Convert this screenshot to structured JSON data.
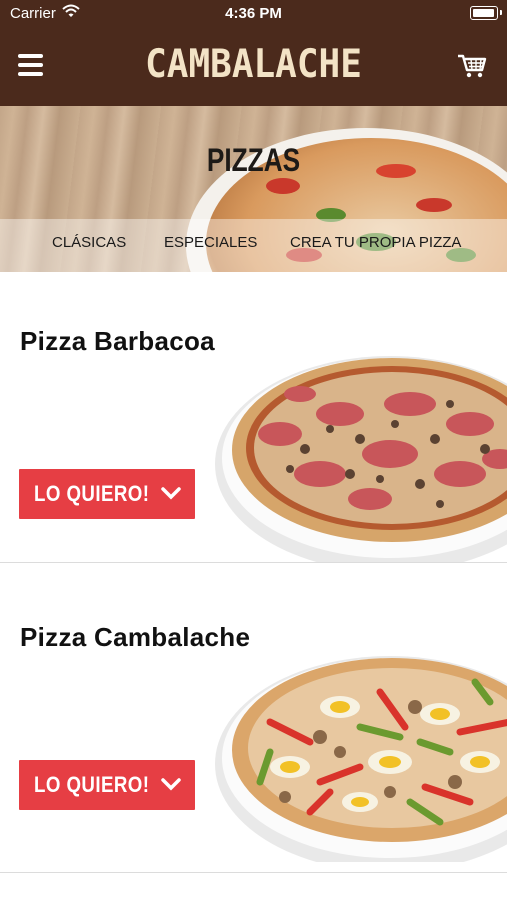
{
  "status_bar": {
    "carrier": "Carrier",
    "time": "4:36 PM",
    "wifi_icon": "wifi-icon",
    "battery_icon": "battery-icon",
    "background": "#4b2a1c"
  },
  "navbar": {
    "brand": "CAMBALACHE",
    "menu_icon": "hamburger-menu-icon",
    "cart_icon": "shopping-cart-icon",
    "background": "#4b2a1c",
    "brand_color": "#f3e3c6"
  },
  "hero": {
    "title": "PIZZAS",
    "tabs": [
      {
        "label": "CLÁSICAS"
      },
      {
        "label": "ESPECIALES"
      },
      {
        "label": "CREA TU PROPIA PIZZA"
      }
    ]
  },
  "products": [
    {
      "name": "Pizza Barbacoa",
      "button_label": "LO QUIERO!",
      "button_icon": "chevron-down-icon",
      "image": "pizza-barbacoa-image"
    },
    {
      "name": "Pizza Cambalache",
      "button_label": "LO QUIERO!",
      "button_icon": "chevron-down-icon",
      "image": "pizza-cambalache-image"
    }
  ],
  "colors": {
    "accent_button": "#e63e44",
    "divider": "#dcdcdc"
  }
}
